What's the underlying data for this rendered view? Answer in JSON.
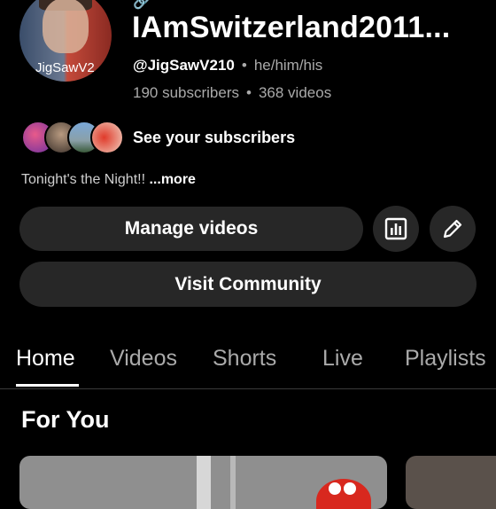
{
  "profile": {
    "avatar_caption": "JigSawV2",
    "channel_name": "IAmSwitzerland2011...",
    "handle": "@JigSawV210",
    "pronouns": "he/him/his",
    "subscribers": "190 subscribers",
    "videos": "368 videos",
    "separator": "•"
  },
  "subscribers_link": "See your subscribers",
  "description": {
    "text": "Tonight's the Night!!",
    "more": "...more"
  },
  "buttons": {
    "manage": "Manage videos",
    "community": "Visit Community",
    "analytics_icon": "analytics-icon",
    "edit_icon": "pencil-icon"
  },
  "tabs": [
    "Home",
    "Videos",
    "Shorts",
    "Live",
    "Playlists"
  ],
  "active_tab": "Home",
  "section_title": "For You",
  "colors": {
    "background": "#000000",
    "button": "#272727",
    "secondary_text": "#aaaaaa"
  }
}
